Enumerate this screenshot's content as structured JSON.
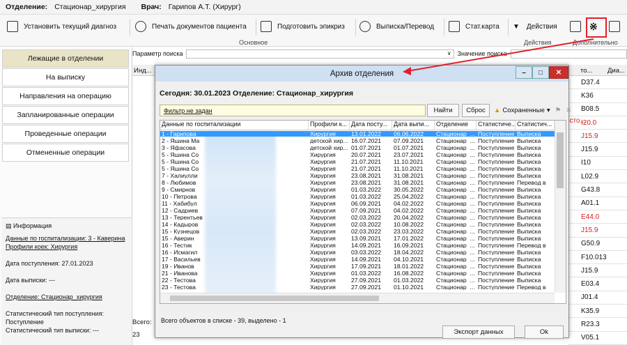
{
  "topbar": {
    "dept_label": "Отделение:",
    "dept_value": "Стационар_хирургия",
    "doctor_label": "Врач:",
    "doctor_value": "Гарипов А.Т. (Хирург)"
  },
  "ribbon": {
    "buttons": [
      "Установить текущий диагноз",
      "Печать документов пациента",
      "Подготовить эпикриз",
      "Выписка/Перевод",
      "Стат.карта",
      "Действия"
    ],
    "groups": {
      "main": "Основное",
      "actions": "Действия",
      "extra": "Дополнительно"
    }
  },
  "sidebar": {
    "items": [
      "Лежащие в отделении",
      "На выписку",
      "Направления на операцию",
      "Запланированные операции",
      "Проведенные операции",
      "Отмененные операции"
    ],
    "info_title": "Информация",
    "info_hosp": "Данные по госпитализации: 3 - Каверина",
    "info_profile": "Профили коек: Хирургия",
    "info_admit": "Дата поступления: 27.01.2023",
    "info_discharge": "Дата выписки: ---",
    "info_dept": "Отделение: Стационар_хирургия",
    "info_stat_in": "Статистический тип поступления: Поступление",
    "info_stat_out": "Статистический тип выписки: ---"
  },
  "main": {
    "search_label": "Параметр поиска",
    "value_label": "Значение поиска",
    "col_ind": "Инд...",
    "col_to": "то...",
    "col_dia": "Диа...",
    "total_label": "Всего:",
    "total_value": "23",
    "right_codes": [
      {
        "code": "D37.4",
        "red": false
      },
      {
        "code": "K36",
        "red": false
      },
      {
        "code": "B08.5",
        "red": false
      },
      {
        "code": "I20.0",
        "red": true
      },
      {
        "code": "J15.9",
        "red": true
      },
      {
        "code": "J15.9",
        "red": false
      },
      {
        "code": "I10",
        "red": false
      },
      {
        "code": "L02.9",
        "red": false
      },
      {
        "code": "G43.8",
        "red": false
      },
      {
        "code": "A01.1",
        "red": false
      },
      {
        "code": "E44.0",
        "red": true
      },
      {
        "code": "J15.9",
        "red": true
      },
      {
        "code": "G50.9",
        "red": false
      },
      {
        "code": "F10.013",
        "red": false
      },
      {
        "code": "J15.9",
        "red": false
      },
      {
        "code": "E03.4",
        "red": false
      },
      {
        "code": "J01.4",
        "red": false
      },
      {
        "code": "K35.9",
        "red": false
      },
      {
        "code": "R23.3",
        "red": false
      },
      {
        "code": "V05.1",
        "red": false
      }
    ],
    "side_red_text": "есто..."
  },
  "dialog": {
    "title": "Архив отделения",
    "today": "Сегодня: 30.01.2023 Отделение: Стационар_хирургия",
    "filter": "Фильтр не задан",
    "find_btn": "Найти",
    "reset_btn": "Сброс",
    "saved_btn": "Сохраненные",
    "columns": [
      "Данные по госпитализации",
      "Профили к...",
      "Дата посту...",
      "Дата выпи...",
      "Отделение",
      "Статистиче...",
      "Статистич..."
    ],
    "rows": [
      [
        "1 - Гарипова",
        "Хирургия",
        "13.01.2022",
        "06.06.2022",
        "Стационар_...",
        "Поступление",
        "Выписка"
      ],
      [
        "2 - Яшина Ма",
        "детской хир...",
        "16.07.2021",
        "07.09.2021",
        "Стационар_...",
        "Поступление",
        "Выписка"
      ],
      [
        "3 - Яфасова",
        "детской хир...",
        "01.07.2021",
        "01.07.2021",
        "Стационар_...",
        "Поступление",
        "Выписка"
      ],
      [
        "5 - Яшина Со",
        "Хирургия",
        "20.07.2021",
        "23.07.2021",
        "Стационар_...",
        "Поступление",
        "Выписка"
      ],
      [
        "5 - Яшина Со",
        "Хирургия",
        "21.07.2021",
        "11.10.2021",
        "Стационар_...",
        "Поступление",
        "Выписка"
      ],
      [
        "5 - Яшина Со",
        "Хирургия",
        "21.07.2021",
        "11.10.2021",
        "Стационар_...",
        "Поступление",
        "Выписка"
      ],
      [
        "7 - Халиулли",
        "Хирургия",
        "23.08.2021",
        "31.08.2021",
        "Стационар_...",
        "Поступление",
        "Выписка"
      ],
      [
        "8 - Любимов",
        "Хирургия",
        "23.08.2021",
        "31.08.2021",
        "Стационар_...",
        "Поступление",
        "Перевод в"
      ],
      [
        "9 - Смирнов",
        "Хирургия",
        "01.03.2022",
        "30.05.2022",
        "Стационар_...",
        "Поступление",
        "Выписка"
      ],
      [
        "10 - Петрова",
        "Хирургия",
        "01.03.2022",
        "25.04.2022",
        "Стационар_...",
        "Поступление",
        "Выписка"
      ],
      [
        "11 - Хабибул",
        "Хирургия",
        "06.09.2021",
        "04.02.2022",
        "Стационар_...",
        "Поступление",
        "Выписка"
      ],
      [
        "12 - Садриев",
        "Хирургия",
        "07.09.2021",
        "04.02.2022",
        "Стационар_...",
        "Поступление",
        "Выписка"
      ],
      [
        "13 - Терентьев",
        "Хирургия",
        "02.03.2022",
        "20.04.2022",
        "Стационар_...",
        "Поступление",
        "Выписка"
      ],
      [
        "14 - Кадыров",
        "Хирургия",
        "02.03.2022",
        "10.08.2022",
        "Стационар_...",
        "Поступление",
        "Выписка"
      ],
      [
        "15 - Кузнецов",
        "Хирургия",
        "02.03.2022",
        "23.03.2022",
        "Стационар_...",
        "Поступление",
        "Выписка"
      ],
      [
        "15 - Аверин",
        "Хирургия",
        "13.09.2021",
        "17.01.2022",
        "Стационар_...",
        "Поступление",
        "Выписка"
      ],
      [
        "16 - Тестик",
        "Хирургия",
        "14.09.2021",
        "16.09.2021",
        "Стационар_...",
        "Поступление",
        "Перевод в"
      ],
      [
        "16 - Исмагил",
        "Хирургия",
        "03.03.2022",
        "18.04.2022",
        "Стационар_...",
        "Поступление",
        "Выписка"
      ],
      [
        "17 - Васильев",
        "Хирургия",
        "14.09.2021",
        "04.10.2021",
        "Стационар_...",
        "Поступление",
        "Выписка"
      ],
      [
        "19 - Иванов",
        "Хирургия",
        "17.09.2021",
        "18.01.2022",
        "Стационар_...",
        "Поступление",
        "Выписка"
      ],
      [
        "21 - Иванова",
        "Хирургия",
        "01.03.2022",
        "16.08.2022",
        "Стационар_...",
        "Поступление",
        "Выписка"
      ],
      [
        "22 - Тестова",
        "Хирургия",
        "27.09.2021",
        "01.03.2022",
        "Стационар_...",
        "Поступление",
        "Выписка"
      ],
      [
        "23 - Тестова",
        "Хирургия",
        "27.09.2021",
        "01.10.2021",
        "Стационар_...",
        "Поступление",
        "Перевод в"
      ]
    ],
    "status": "Всего объектов в списке - 39, выделено - 1",
    "export_btn": "Экспорт данных",
    "ok_btn": "Ok"
  }
}
